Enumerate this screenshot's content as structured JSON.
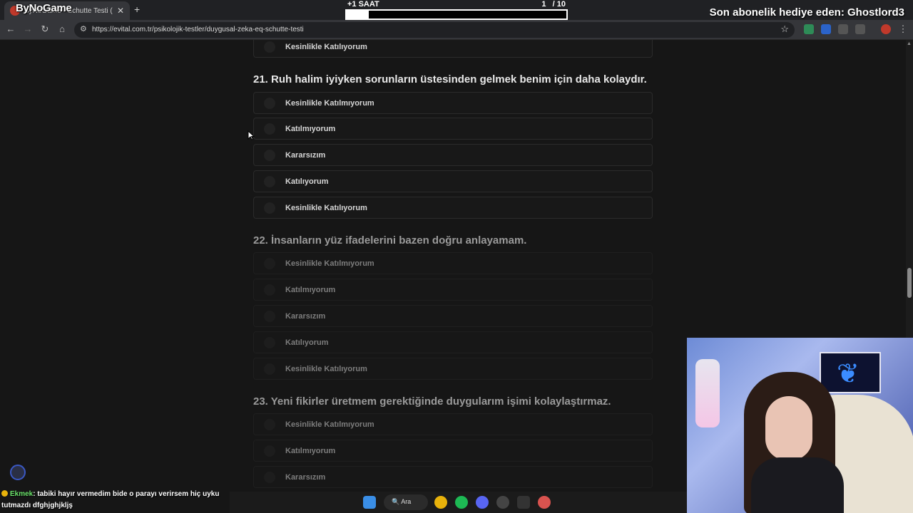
{
  "browser": {
    "tab_title": "ByNoGame - Schutte Testi (Duygusal Zeka)",
    "url": "https://evital.com.tr/psikolojik-testler/duygusal-zeka-eq-schutte-testi"
  },
  "overlay": {
    "logo_text": "ByNoGame",
    "timer_label": "+1 SAAT",
    "timer_count": "1   / 10",
    "timer_progress": 0.1,
    "sub_gift": "Son abonelik hediye eden: Ghostlord3"
  },
  "prev_last_option": "Kesinlikle Katılıyorum",
  "questions": [
    {
      "title": "21. Ruh halim iyiyken sorunların üstesinden gelmek benim için daha kolaydır.",
      "options": [
        "Kesinlikle Katılmıyorum",
        "Katılmıyorum",
        "Kararsızım",
        "Katılıyorum",
        "Kesinlikle Katılıyorum"
      ]
    },
    {
      "title": "22. İnsanların yüz ifadelerini bazen doğru anlayamam.",
      "options": [
        "Kesinlikle Katılmıyorum",
        "Katılmıyorum",
        "Kararsızım",
        "Katılıyorum",
        "Kesinlikle Katılıyorum"
      ]
    },
    {
      "title": "23. Yeni fikirler üretmem gerektiğinde duygularım işimi kolaylaştırmaz.",
      "options": [
        "Kesinlikle Katılmıyorum",
        "Katılmıyorum",
        "Kararsızım"
      ]
    }
  ],
  "chat": {
    "user": "Ekmek",
    "message": ": tabiki hayır vermedim bide o parayı verirsem hiç uyku tutmazdı dfghjghjkljş"
  },
  "taskbar": {
    "search_label": "Ara"
  },
  "colors": {
    "page_bg": "#161616",
    "chat_user": "#6be36b",
    "scroll_thumb": "#8a8a8a"
  }
}
